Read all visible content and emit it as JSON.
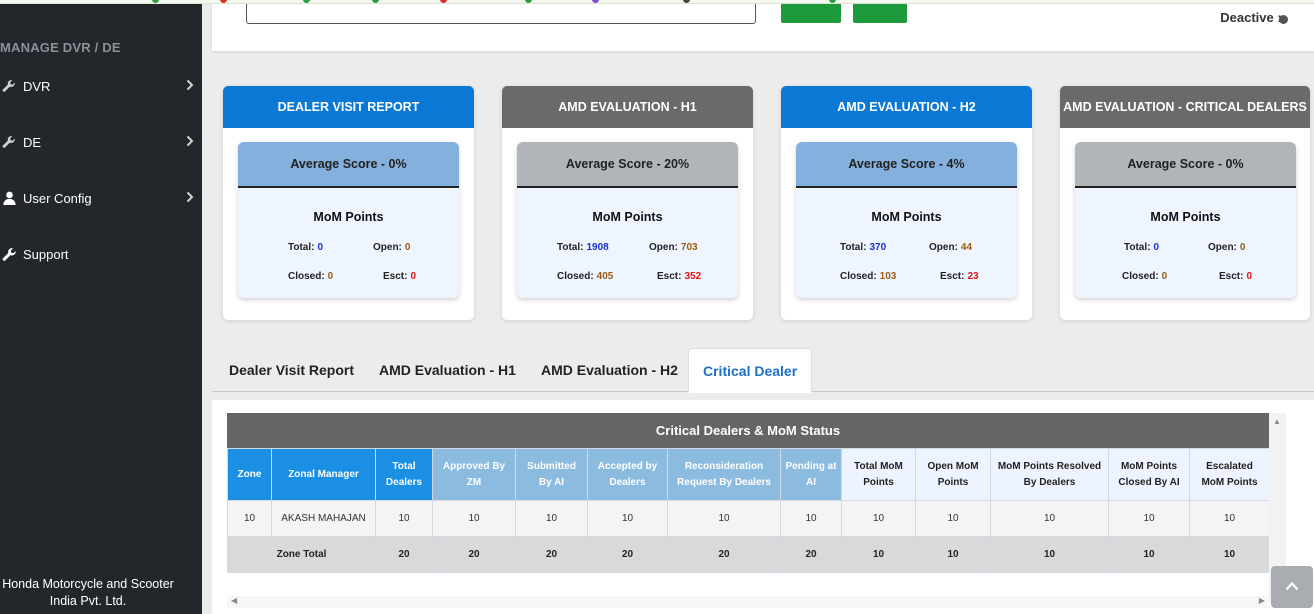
{
  "sidebar": {
    "title": "MANAGE DVR / DE",
    "items": [
      {
        "label": "DVR",
        "icon": "wrench-icon"
      },
      {
        "label": "DE",
        "icon": "wrench-icon"
      },
      {
        "label": "User Config",
        "icon": "user-icon"
      },
      {
        "label": "Support",
        "icon": "wrench-icon"
      }
    ],
    "footer": "Honda Motorcycle and Scooter India Pvt. Ltd."
  },
  "header": {
    "deactive_label": "Deactive :-"
  },
  "cards": [
    {
      "title": "DEALER VISIT REPORT",
      "average": "Average Score - 0%",
      "mom_title": "MoM Points",
      "total_label": "Total:",
      "total": "0",
      "open_label": "Open:",
      "open": "0",
      "closed_label": "Closed:",
      "closed": "0",
      "esct_label": "Esct:",
      "esct": "0"
    },
    {
      "title": "AMD EVALUATION - H1",
      "average": "Average Score - 20%",
      "mom_title": "MoM Points",
      "total_label": "Total:",
      "total": "1908",
      "open_label": "Open:",
      "open": "703",
      "closed_label": "Closed:",
      "closed": "405",
      "esct_label": "Esct:",
      "esct": "352"
    },
    {
      "title": "AMD EVALUATION - H2",
      "average": "Average Score - 4%",
      "mom_title": "MoM Points",
      "total_label": "Total:",
      "total": "370",
      "open_label": "Open:",
      "open": "44",
      "closed_label": "Closed:",
      "closed": "103",
      "esct_label": "Esct:",
      "esct": "23"
    },
    {
      "title": "AMD EVALUATION - CRITICAL DEALERS",
      "average": "Average Score - 0%",
      "mom_title": "MoM Points",
      "total_label": "Total:",
      "total": "0",
      "open_label": "Open:",
      "open": "0",
      "closed_label": "Closed:",
      "closed": "0",
      "esct_label": "Esct:",
      "esct": "0"
    }
  ],
  "tabs": [
    {
      "label": "Dealer Visit Report"
    },
    {
      "label": "AMD Evaluation - H1"
    },
    {
      "label": "AMD Evaluation - H2"
    },
    {
      "label": "Critical Dealer"
    }
  ],
  "active_tab": "Critical Dealer",
  "table": {
    "title": "Critical Dealers & MoM Status",
    "headers": [
      "Zone",
      "Zonal Manager",
      "Total Dealers",
      "Approved By ZM",
      "Submitted By AI",
      "Accepted by Dealers",
      "Reconsideration Request By Dealers",
      "Pending at AI",
      "Total MoM Points",
      "Open MoM Points",
      "MoM Points Resolved By Dealers",
      "MoM Points Closed By AI",
      "Escalated MoM Points"
    ],
    "rows": [
      [
        "10",
        "AKASH MAHAJAN",
        "10",
        "10",
        "10",
        "10",
        "10",
        "10",
        "10",
        "10",
        "10",
        "10",
        "10"
      ]
    ],
    "total_row": [
      "Zone Total",
      "20",
      "20",
      "20",
      "20",
      "20",
      "20",
      "10",
      "10",
      "10",
      "10",
      "10"
    ]
  },
  "colors": {
    "sidebar_bg": "#23262b",
    "blue_header": "#0c78d6",
    "gray_header": "#6a6a6a",
    "active_tab": "#1c6fc6",
    "value_blue": "#1a2fd0",
    "value_brown": "#9a5b12",
    "value_red": "#e01414"
  }
}
